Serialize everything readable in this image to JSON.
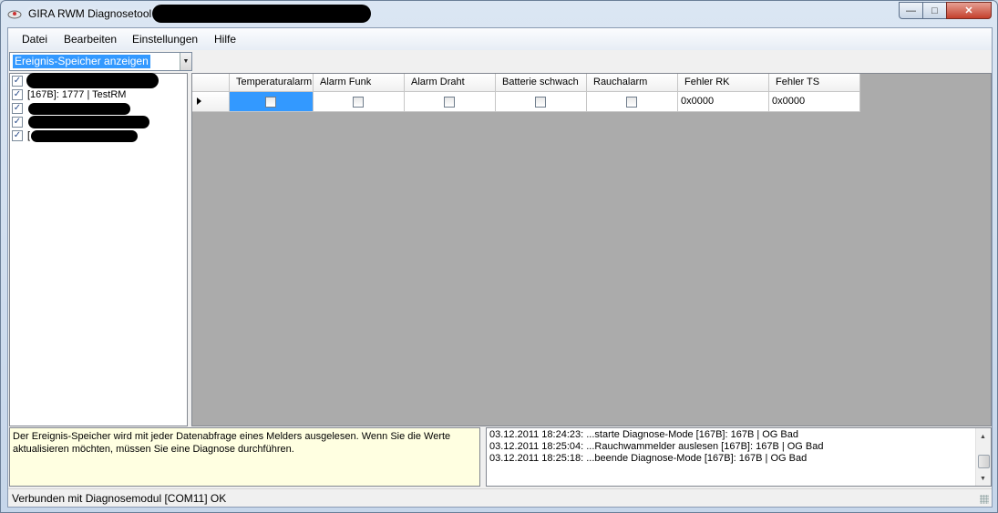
{
  "window": {
    "title": "GIRA RWM Diagnosetool"
  },
  "menu": {
    "items": [
      "Datei",
      "Bearbeiten",
      "Einstellungen",
      "Hilfe"
    ]
  },
  "combo": {
    "selected": "Ereignis-Speicher anzeigen"
  },
  "tree": {
    "items": [
      {
        "label": "",
        "checked": true,
        "selected": true
      },
      {
        "label": "[167B]: 1777 | TestRM",
        "checked": true,
        "selected": false
      },
      {
        "label": "",
        "checked": true,
        "selected": false
      },
      {
        "label": "",
        "checked": true,
        "selected": false
      },
      {
        "label": "[",
        "checked": true,
        "selected": false
      }
    ]
  },
  "grid": {
    "columns": [
      "Temperaturalarm",
      "Alarm Funk",
      "Alarm Draht",
      "Batterie schwach",
      "Rauchalarm",
      "Fehler RK",
      "Fehler TS"
    ],
    "row": {
      "temperaturalarm": false,
      "alarm_funk": false,
      "alarm_draht": false,
      "batterie_schwach": false,
      "rauchalarm": false,
      "fehler_rk": "0x0000",
      "fehler_ts": "0x0000"
    }
  },
  "info": {
    "text": "Der Ereignis-Speicher wird mit jeder Datenabfrage eines Melders ausgelesen. Wenn Sie die Werte aktualisieren möchten, müssen Sie eine Diagnose durchführen."
  },
  "log": {
    "lines": [
      "03.12.2011 18:24:23: ...starte Diagnose-Mode [167B]: 167B | OG Bad",
      "03.12.2011 18:25:04: ...Rauchwammelder auslesen [167B]: 167B | OG Bad",
      "03.12.2011 18:25:18: ...beende Diagnose-Mode [167B]: 167B | OG Bad"
    ]
  },
  "status": {
    "text": "Verbunden mit Diagnosemodul [COM11]  OK"
  }
}
